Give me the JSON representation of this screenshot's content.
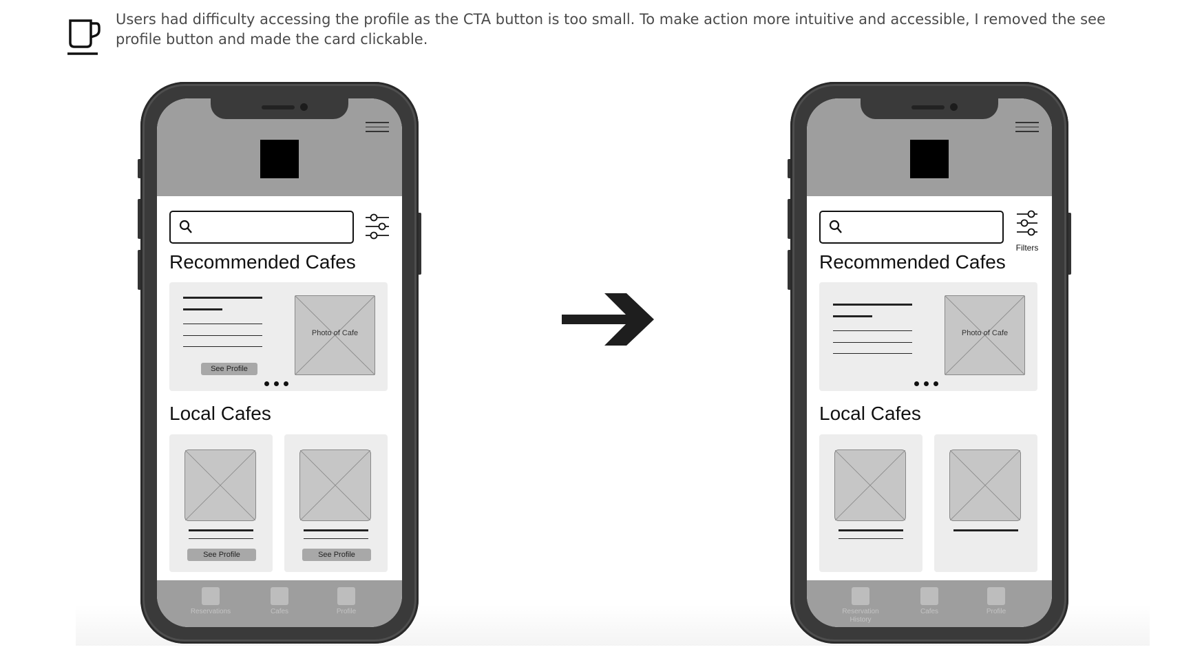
{
  "intro": {
    "icon": "coffee-cup-icon",
    "text": "Users had difficulty accessing the profile as the CTA button is too small. To make action more intuitive and accessible, I removed the see profile button and made the card clickable."
  },
  "before": {
    "recommended_title": "Recommended Cafes",
    "photo_label": "Photo of Cafe",
    "see_profile": "See Profile",
    "local_title": "Local Cafes",
    "local_see_profile": [
      "See Profile",
      "See Profile"
    ],
    "tabs": [
      "Reservations",
      "Cafes",
      "Profile"
    ]
  },
  "after": {
    "recommended_title": "Recommended Cafes",
    "photo_label": "Photo of Cafe",
    "filters_label": "Filters",
    "local_title": "Local Cafes",
    "tabs": [
      "Reservation History",
      "Cafes",
      "Profile"
    ]
  },
  "icons": {
    "menu": "hamburger-menu-icon",
    "search": "search-icon",
    "filter": "filter-sliders-icon",
    "transition": "right-arrow-icon"
  },
  "colors": {
    "hero_bg": "#9e9e9e",
    "card_bg": "#ededed",
    "phone_frame": "#3a3a3a",
    "text": "#4a4a4a"
  }
}
